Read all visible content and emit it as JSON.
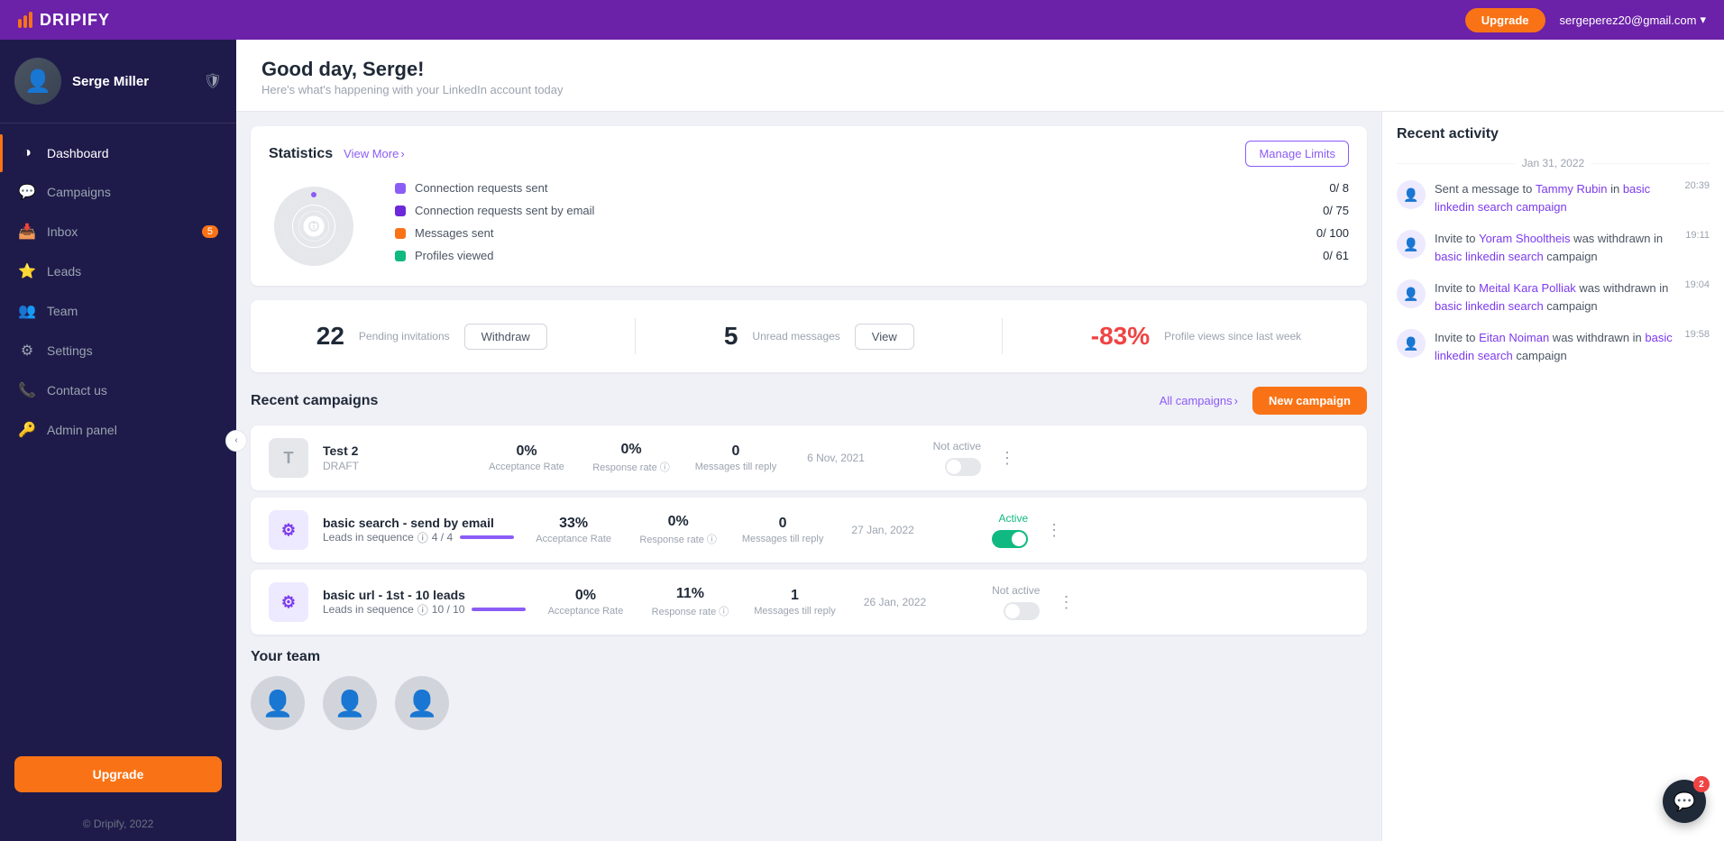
{
  "topnav": {
    "logo_text": "DRIPIFY",
    "upgrade_label": "Upgrade",
    "user_email": "sergeperez20@gmail.com"
  },
  "sidebar": {
    "user_name": "Serge Miller",
    "nav_items": [
      {
        "id": "dashboard",
        "label": "Dashboard",
        "active": true,
        "badge": null
      },
      {
        "id": "campaigns",
        "label": "Campaigns",
        "active": false,
        "badge": null
      },
      {
        "id": "inbox",
        "label": "Inbox",
        "active": false,
        "badge": "5"
      },
      {
        "id": "leads",
        "label": "Leads",
        "active": false,
        "badge": null
      },
      {
        "id": "team",
        "label": "Team",
        "active": false,
        "badge": null
      },
      {
        "id": "settings",
        "label": "Settings",
        "active": false,
        "badge": null
      },
      {
        "id": "contact-us",
        "label": "Contact us",
        "active": false,
        "badge": null
      },
      {
        "id": "admin-panel",
        "label": "Admin panel",
        "active": false,
        "badge": null
      }
    ],
    "upgrade_btn": "Upgrade",
    "footer": "© Dripify, 2022"
  },
  "page": {
    "greeting": "Good day, Serge!",
    "subtitle": "Here's what's happening with your LinkedIn account today"
  },
  "statistics": {
    "title": "Statistics",
    "view_more": "View More",
    "manage_limits": "Manage Limits",
    "items": [
      {
        "label": "Connection requests sent",
        "value": "0/ 8",
        "color": "#8b5cf6"
      },
      {
        "label": "Connection requests sent by email",
        "value": "0/ 75",
        "color": "#6d28d9"
      },
      {
        "label": "Messages sent",
        "value": "0/ 100",
        "color": "#f97316"
      },
      {
        "label": "Profiles viewed",
        "value": "0/ 61",
        "color": "#10b981"
      }
    ]
  },
  "metrics": {
    "pending_count": "22",
    "pending_label": "Pending invitations",
    "withdraw_btn": "Withdraw",
    "unread_count": "5",
    "unread_label": "Unread messages",
    "view_btn": "View",
    "profile_views": "-83%",
    "profile_views_label": "Profile views since last week"
  },
  "campaigns": {
    "title": "Recent campaigns",
    "all_label": "All campaigns",
    "new_btn": "New campaign",
    "list": [
      {
        "icon": "T",
        "icon_type": "draft",
        "name": "Test 2",
        "type": "DRAFT",
        "leads_label": null,
        "leads_progress": null,
        "acceptance": "0%",
        "response": "0%",
        "messages": "0",
        "date": "6 Nov, 2021",
        "status": "Not active",
        "active": false
      },
      {
        "icon": "⚙",
        "icon_type": "gear",
        "name": "basic search - send by email",
        "type": "Leads in sequence",
        "leads_label": "4 / 4",
        "leads_progress": 100,
        "acceptance": "33%",
        "response": "0%",
        "messages": "0",
        "date": "27 Jan, 2022",
        "status": "Active",
        "active": true
      },
      {
        "icon": "⚙",
        "icon_type": "gear",
        "name": "basic url - 1st - 10 leads",
        "type": "Leads in sequence",
        "leads_label": "10 / 10",
        "leads_progress": 100,
        "acceptance": "0%",
        "response": "11%",
        "messages": "1",
        "date": "26 Jan, 2022",
        "status": "Not active",
        "active": false
      }
    ]
  },
  "team": {
    "title": "Your team"
  },
  "activity": {
    "title": "Recent activity",
    "date_label": "Jan 31, 2022",
    "items": [
      {
        "text_before": "Sent a message to ",
        "link1": "Tammy Rubin",
        "text_middle": " in ",
        "link2": "basic linkedin search campaign",
        "text_after": "",
        "time": "20:39"
      },
      {
        "text_before": "Invite to ",
        "link1": "Yoram Shooltheis",
        "text_middle": " was withdrawn in ",
        "link2": "basic linkedin search",
        "text_after": " campaign",
        "time": "19:11"
      },
      {
        "text_before": "Invite to ",
        "link1": "Meital Kara Polliak",
        "text_middle": " was withdrawn in ",
        "link2": "basic linkedin search",
        "text_after": " campaign",
        "time": "19:04"
      },
      {
        "text_before": "Invite to ",
        "link1": "Eitan Noiman",
        "text_middle": " was withdrawn in ",
        "link2": "basic linkedin search",
        "text_after": " campaign",
        "time": "19:58"
      }
    ]
  },
  "chat": {
    "badge": "2"
  }
}
